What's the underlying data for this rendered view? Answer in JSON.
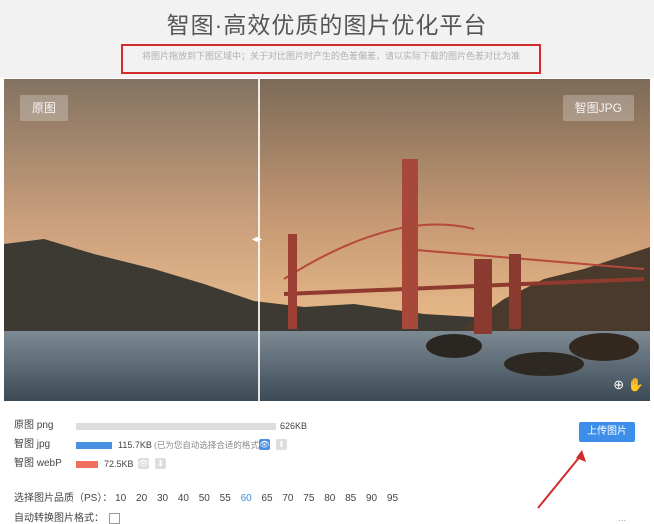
{
  "header": {
    "title": "智图·高效优质的图片优化平台",
    "subtitle": "将图片拖放到下图区域中；关于对比图片时产生的色差偏差，请以实际下载的图片色差对比为准"
  },
  "compare": {
    "left_label": "原图",
    "right_label": "智图JPG",
    "handle_glyph": "◂▸",
    "icons": [
      "zoom-in-icon",
      "drop-icon"
    ]
  },
  "files": [
    {
      "name": "原图 png",
      "size": "626KB",
      "bar_fraction": 1.0,
      "color": "#dddddd"
    },
    {
      "name": "智图 jpg",
      "size": "115.7KB",
      "note": "(已为您自动选择合适的格式)",
      "bar_fraction": 0.25,
      "color": "#4a90e2"
    },
    {
      "name": "智图 webP",
      "size": "72.5KB",
      "bar_fraction": 0.1,
      "color": "#f07060"
    }
  ],
  "quality": {
    "label": "选择图片品质（PS）：",
    "options": [
      "10",
      "20",
      "30",
      "40",
      "50",
      "55",
      "60",
      "65",
      "70",
      "75",
      "80",
      "85",
      "90",
      "95"
    ],
    "selected": "60"
  },
  "auto_convert": {
    "label": "自动转换图片格式："
  },
  "upload": {
    "label": "上传图片"
  },
  "corner_text": "...",
  "colors": {
    "accent": "#3d8ee8",
    "highlight_border": "#d12b2b",
    "arrow": "#d12b2b"
  }
}
